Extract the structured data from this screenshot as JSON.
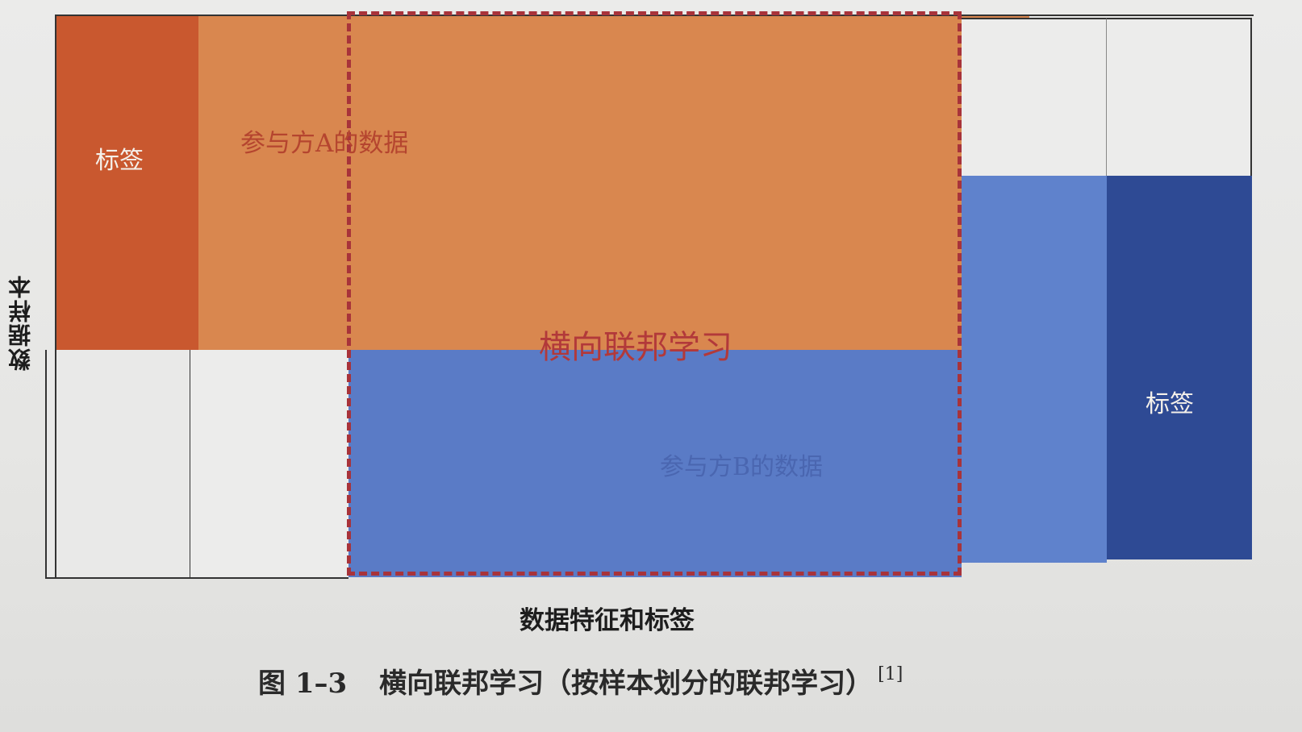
{
  "diagram": {
    "label_tag_a": "标签",
    "party_a_data": "参与方A的数据",
    "horizontal_fl": "横向联邦学习",
    "party_b_data": "参与方B的数据",
    "label_tag_b": "标签",
    "y_axis_label": "数据样本",
    "x_axis_label": "数据特征和标签"
  },
  "caption": {
    "figure_number": "图 1–3",
    "title": "横向联邦学习（按样本划分的联邦学习）",
    "reference": "[1]"
  },
  "colors": {
    "party_a_label": "#c9582f",
    "party_a_data": "#d9874f",
    "party_b_data": "#5a7bc6",
    "party_b_label": "#2e4a94",
    "dashed_highlight": "#a8333a"
  }
}
